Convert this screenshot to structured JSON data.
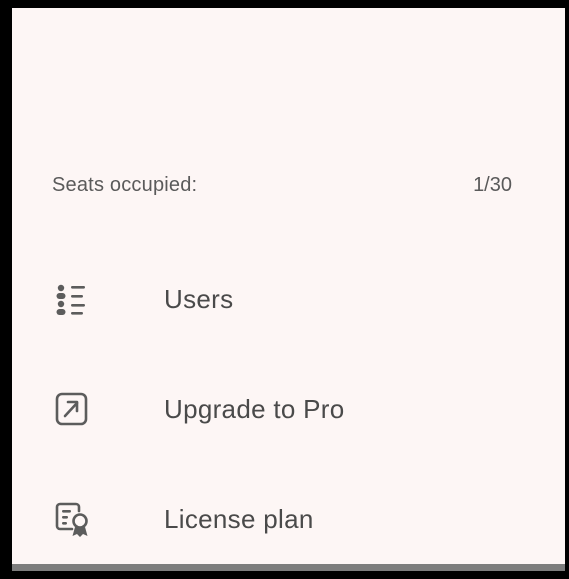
{
  "colors": {
    "panel_background": "#fdf6f5",
    "text_primary": "#4a4a4a",
    "text_secondary": "#5a5a5a",
    "icon": "#5c5c5c"
  },
  "seats": {
    "label": "Seats occupied:",
    "value": "1/30"
  },
  "menu": {
    "items": [
      {
        "label": "Users",
        "icon": "user-list-icon"
      },
      {
        "label": "Upgrade to Pro",
        "icon": "external-arrow-icon"
      },
      {
        "label": "License plan",
        "icon": "license-certificate-icon"
      }
    ]
  }
}
